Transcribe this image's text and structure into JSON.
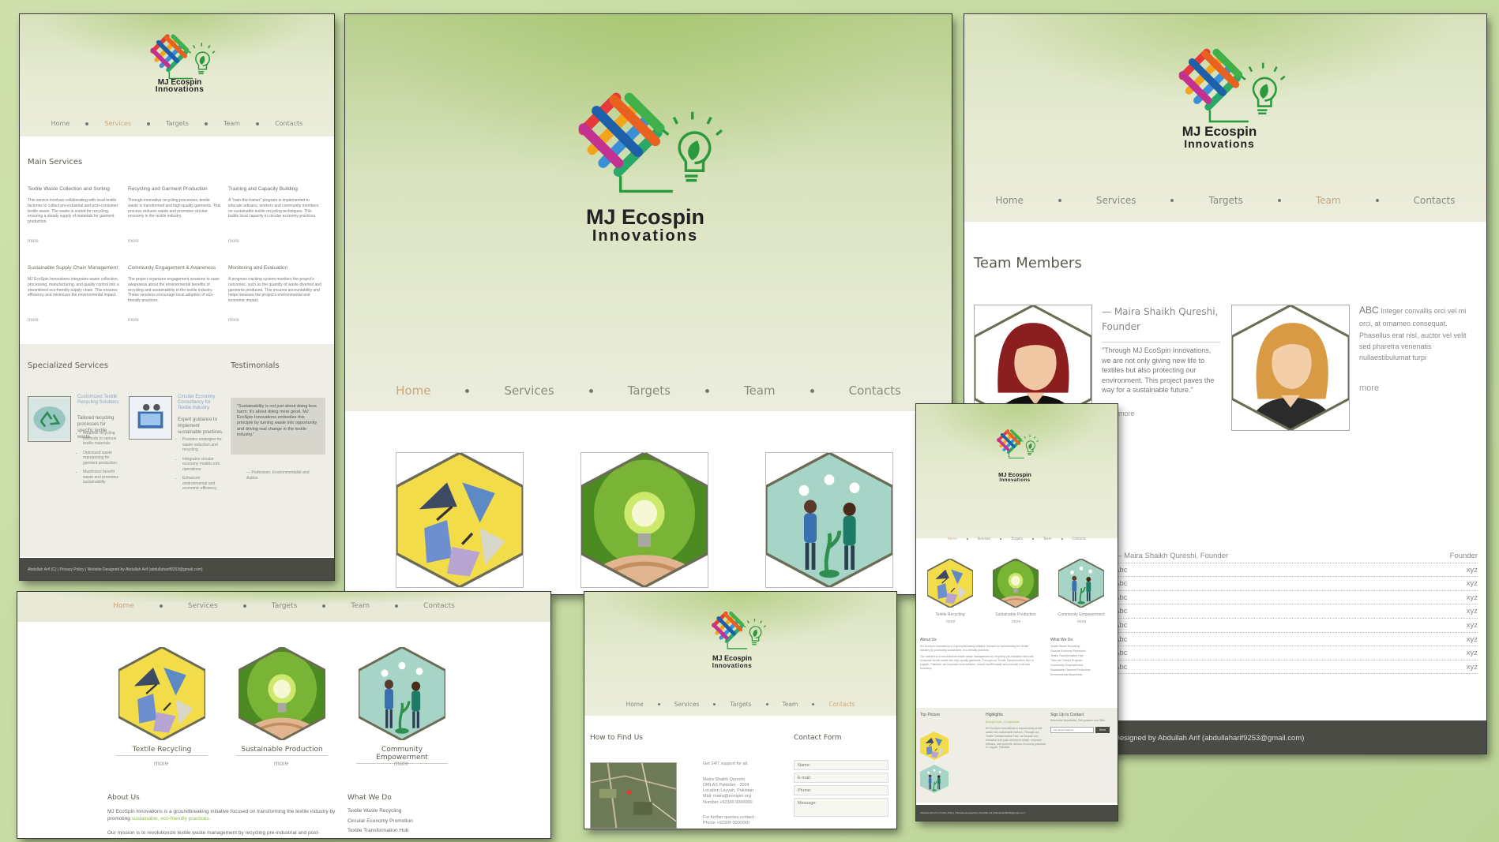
{
  "brand": {
    "name_line1": "MJ Ecospin",
    "name_line2": "Innovations"
  },
  "colors": {
    "accent": "#c9a57c",
    "header_green": "#9dc360",
    "footer": "#4a4b44",
    "title": "#5b5b4f"
  },
  "nav": {
    "home": "Home",
    "services": "Services",
    "targets": "Targets",
    "team": "Team",
    "contacts": "Contacts"
  },
  "services_page": {
    "main_title": "Main Services",
    "services": [
      {
        "title": "Textile Waste Collection and Sorting",
        "text": "This service involves collaborating with local textile factories to collect pre-industrial and post-consumer textile waste. The waste is sorted for recycling, ensuring a steady supply of materials for garment production.",
        "more": "more"
      },
      {
        "title": "Recycling and Garment Production",
        "text": "Through innovative recycling processes, textile waste is transformed and high-quality garments. This process reduces waste and promotes circular economy in the textile industry.",
        "more": "more"
      },
      {
        "title": "Training and Capacity Building",
        "text": "A \"train-the-trainer\" program is implemented to educate artisans, workers and community members on sustainable textile recycling techniques. This builds local capacity in circular economy practices.",
        "more": "more"
      },
      {
        "title": "Sustainable Supply Chain Management",
        "text": "MJ EcoSpin Innovations integrates waste collection, processing, manufacturing, and quality control into a streamlined eco-friendly supply chain. This ensures efficiency and minimizes the environmental impact.",
        "more": "more"
      },
      {
        "title": "Community Engagement & Awareness",
        "text": "The project organizes engagement sessions to raise awareness about the environmental benefits of recycling and sustainability in the textile industry. These sessions encourage local adoption of eco-friendly practices.",
        "more": "more"
      },
      {
        "title": "Monitoring and Evaluation",
        "text": "A progress tracking system monitors the project's outcomes, such as the quantity of waste diverted and garments produced. This ensures accountability and helps measure the project's environmental and economic impact.",
        "more": "more"
      }
    ],
    "specialized_title": "Specialized Services",
    "testimonials_title": "Testimonials",
    "spec1_title": "Customized Textile Recycling Solutions",
    "spec1_text": "Tailored recycling processes for specific textile waste.",
    "spec1_bullets": [
      "Adaptive recycling methods to various textile materials",
      "Optimized waste repurposing for garment production",
      "Maximizes benefit waste and promotes sustainability"
    ],
    "spec2_title": "Circular Economy Consultancy for Textile Industry",
    "spec2_text": "Expert guidance to implement sustainable practices.",
    "spec2_bullets": [
      "Provides strategies for waste reduction and recycling",
      "Integrates circular economy models into operations",
      "Enhances environmental and economic efficiency"
    ],
    "quote": "\"Sustainability is not just about doing less harm; it's about doing more good. MJ EcoSpin Innovations embodies this principle by turning waste into opportunity and driving real change in the textile industry.\"",
    "quote_author": "— Profession, Environmentalist and Author",
    "footer": "Abdullah Arif (C) | Privacy Policy | Website Designed by Abdullah Arif (abdullaharif9253@gmail.com)"
  },
  "home_page": {
    "cards": [
      "Textile Recycling",
      "Sustainable Production",
      "Community Empowerment"
    ],
    "more": "more",
    "about_title": "About Us",
    "what_title": "What We Do",
    "about_text1": "MJ EcoSpin Innovations is a groundbreaking initiative focused on transforming the textile industry by promoting",
    "about_link": "sustainable, eco-friendly practices.",
    "about_text2": "Our mission is to revolutionize textile waste management by recycling pre-industrial and post-",
    "what_items": [
      "Textile Waste Recycling",
      "Circular Economy Promotion",
      "Textile Transformation Hub"
    ]
  },
  "team_page": {
    "title": "Team Members",
    "member1_name": "— Maira Shaikh Qureshi, Founder",
    "member1_quote": "\"Through MJ EcoSpin Innovations, we are not only giving new life to textiles but also protecting our environment. This project paves the way for a sustainable future.\"",
    "member1_more": "more",
    "member2_name": "ABC",
    "member2_text": "Integer convallis orci vel mi orci, at ornamen consequat. Phasellus erat nisl, auctor vel velit sed pharetra venenatis nullaestibulumat turpi",
    "member2_more": "more",
    "list": [
      [
        "— Maira Shaikh Qureshi, Founder",
        "Founder"
      ],
      [
        "Abc",
        "xyz"
      ],
      [
        "Abc",
        "xyz"
      ],
      [
        "Abc",
        "xyz"
      ],
      [
        "Abc",
        "xyz"
      ],
      [
        "Abc",
        "xyz"
      ],
      [
        "Abc",
        "xyz"
      ],
      [
        "Abc",
        "xyz"
      ],
      [
        "Abc",
        "xyz"
      ]
    ],
    "footer": "Designed by Abdullah Arif (abdullaharif9253@gmail.com)"
  },
  "contact_page": {
    "find_title": "How to Find Us",
    "form_title": "Contact Form",
    "support": "Get 24/7 support for all.",
    "address": "Maira Shaikh Qureshi\nDMLAS Pakistan - 2024\nLocation Layyah, Pakistan\nMail: maira@ecospin.org\nNumber +92300 0000000",
    "queries": "For further queries,contact:\nPhone +92300 0000000",
    "fields": [
      "Name:",
      "E-mail:",
      "Phone:",
      "Message:"
    ]
  },
  "mobile_page": {
    "cards": [
      "Textile Recycling",
      "Sustainable Production",
      "Community Empowerment"
    ],
    "more": "more",
    "about_title": "About Us",
    "what_title": "What We Do",
    "about_text": "MJ EcoSpin Innovations is a groundbreaking initiative focused on transforming the textile industry by promoting sustainable, eco-friendly practices.",
    "about_text2": "Our mission is to revolutionize textile waste management by recycling pre-industrial and post-consumer textile waste into high-quality garments. Through our Textile Transformation Hub in Layyah, Pakistan, we empower local artisans, reduce landfill waste and promote a circular economy.",
    "what_items": [
      "Textile Waste Recycling",
      "Circular Economy Promotion",
      "Textile Transformation Hub",
      "Train-the-Trainer Program",
      "Community Empowerment",
      "Sustainable Garment Production",
      "Environmental Awareness"
    ],
    "top_picture": "Top Picture",
    "highlights": "Highlights",
    "signup": "Sign Up to Contact",
    "signup_text": "Subscribe Newsletter, Get updates and Offer",
    "email_placeholder": "Your Email Address",
    "send": "Send",
    "highlights_title": "Ecospin Hub - Crumbleable",
    "highlights_text": "MJ EcoSpin Innovations is transforming textile waste into sustainable fashion. Through our Textile Transformation Hub, we recycle pre-industrial and post-consumer waste, empower artisans, and promote circular economy practices in Layyah, Pakistan.",
    "footer": "Abdullah Arif (C) | Privacy Policy | Website Designed by Abdullah Arif (abdullaharif9253@gmail.com)"
  }
}
